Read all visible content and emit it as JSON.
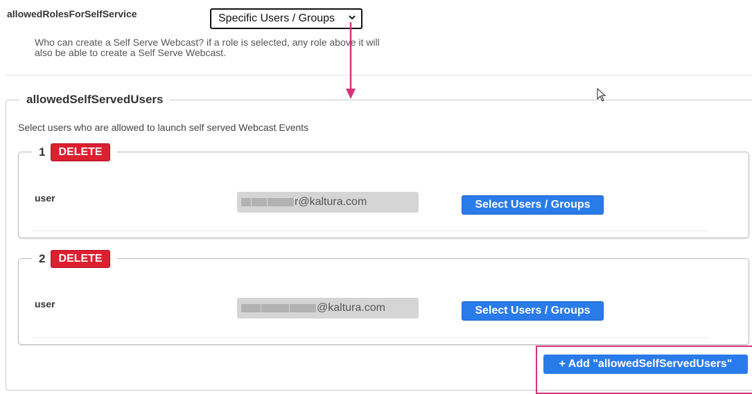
{
  "role_setting": {
    "label": "allowedRolesForSelfService",
    "selected_value": "Specific Users / Groups",
    "help_text": "Who can create a Self Serve Webcast? if a role is selected, any role above it will also be able to create a Self Serve Webcast."
  },
  "users_section": {
    "title": "allowedSelfServedUsers",
    "description": "Select users who are allowed to launch self served Webcast Events",
    "items": [
      {
        "index": "1",
        "delete_label": "DELETE",
        "field_label": "user",
        "email_visible": "r@kaltura.com",
        "select_label": "Select Users / Groups"
      },
      {
        "index": "2",
        "delete_label": "DELETE",
        "field_label": "user",
        "email_visible": "@kaltura.com",
        "select_label": "Select Users / Groups"
      }
    ],
    "add_label": "+ Add \"allowedSelfServedUsers\""
  },
  "colors": {
    "primary": "#2a7bea",
    "danger": "#dc2030",
    "annotation": "#d6337a"
  }
}
